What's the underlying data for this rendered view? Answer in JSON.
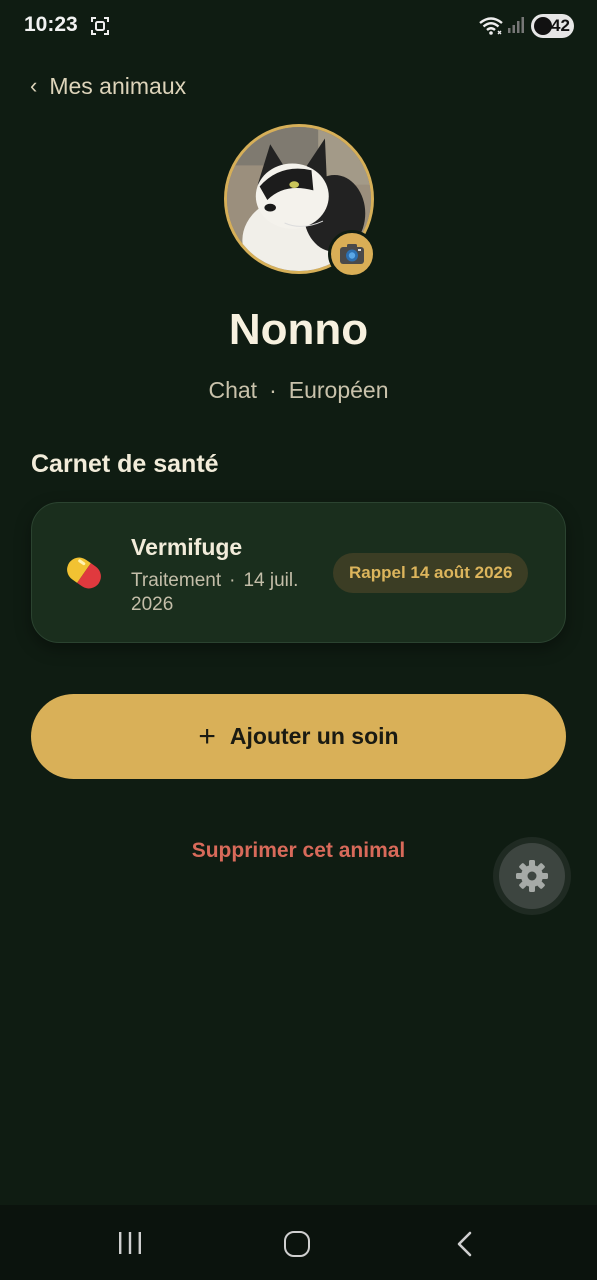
{
  "status_bar": {
    "time": "10:23",
    "battery": "42",
    "icons": [
      "screenshot-icon",
      "wifi-icon",
      "signal-icon",
      "battery-icon"
    ]
  },
  "header": {
    "back_label": "Mes animaux"
  },
  "pet": {
    "name": "Nonno",
    "species": "Chat",
    "separator": "·",
    "breed": "Européen"
  },
  "health": {
    "section_title": "Carnet de santé",
    "entries": [
      {
        "icon": "pill-icon",
        "title": "Vermifuge",
        "category": "Traitement",
        "separator": "·",
        "date": "14 juil. 2026",
        "reminder": "Rappel 14 août 2026"
      }
    ]
  },
  "actions": {
    "add_care_label": "Ajouter un soin",
    "add_icon": "+",
    "delete_label": "Supprimer cet animal"
  },
  "colors": {
    "background": "#0f1c12",
    "card": "#1a2e1d",
    "accent": "#d9b058",
    "danger": "#d86a5a",
    "badge_bg": "#3b3d24"
  }
}
